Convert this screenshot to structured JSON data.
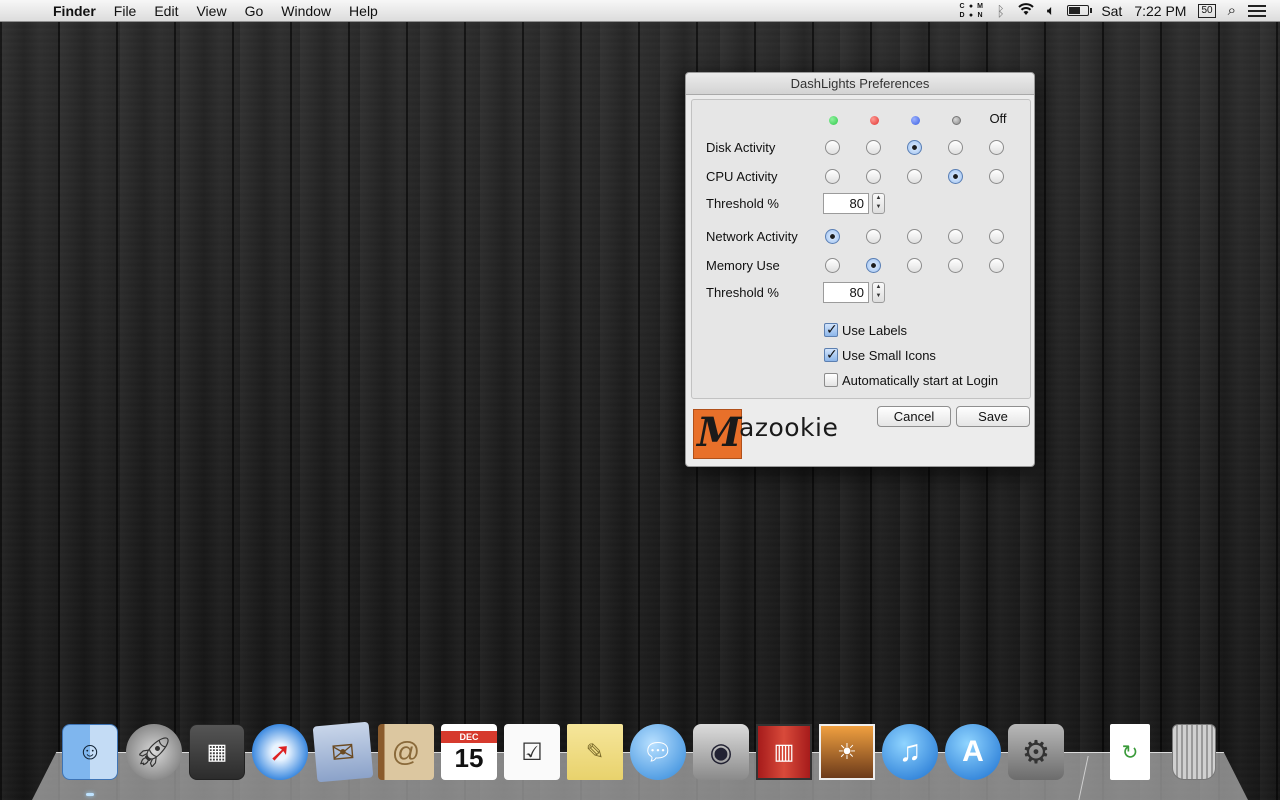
{
  "menubar": {
    "apple_glyph": "",
    "items": [
      {
        "label": "Finder",
        "bold": true
      },
      {
        "label": "File"
      },
      {
        "label": "Edit"
      },
      {
        "label": "View"
      },
      {
        "label": "Go"
      },
      {
        "label": "Window"
      },
      {
        "label": "Help"
      }
    ],
    "status": {
      "dashlights_letters": [
        "C",
        "",
        "M",
        "D",
        "",
        "N"
      ],
      "bluetooth_icon": "bluetooth-icon",
      "wifi_icon": "wifi-icon",
      "volume_icon": "volume-icon",
      "battery_level": 0.55,
      "day": "Sat",
      "time": "7:22 PM",
      "calendar_badge": "50"
    }
  },
  "dialog": {
    "title": "DashLights Preferences",
    "columns": [
      {
        "id": "green",
        "color": "#2ec84a"
      },
      {
        "id": "red",
        "color": "#e0322e"
      },
      {
        "id": "blue",
        "color": "#3a5fe0"
      },
      {
        "id": "gray",
        "color": "#8a8a8a"
      },
      {
        "id": "off",
        "label": "Off"
      }
    ],
    "rows": {
      "disk": {
        "label": "Disk Activity",
        "selected": "blue"
      },
      "cpu": {
        "label": "CPU Activity",
        "selected": "gray"
      },
      "cpu_threshold": {
        "label": "Threshold %",
        "value": "80"
      },
      "network": {
        "label": "Network Activity",
        "selected": "green"
      },
      "memory": {
        "label": "Memory Use",
        "selected": "red"
      },
      "memory_threshold": {
        "label": "Threshold %",
        "value": "80"
      }
    },
    "checkboxes": {
      "use_labels": {
        "label": "Use Labels",
        "checked": true
      },
      "use_small_icons": {
        "label": "Use Small Icons",
        "checked": true
      },
      "auto_start": {
        "label": "Automatically start at Login",
        "checked": false
      }
    },
    "buttons": {
      "cancel": "Cancel",
      "save": "Save"
    },
    "logo": {
      "mark": "M",
      "text": "azookie",
      "color": "#e8702a"
    }
  },
  "dock": {
    "apps": [
      {
        "name": "Finder",
        "icon": "finder-icon",
        "running": true
      },
      {
        "name": "Launchpad",
        "icon": "rocket-icon"
      },
      {
        "name": "Mission Control",
        "icon": "mission-control-icon"
      },
      {
        "name": "Safari",
        "icon": "compass-icon"
      },
      {
        "name": "Mail",
        "icon": "eagle-stamp-icon"
      },
      {
        "name": "Contacts",
        "icon": "address-book-icon"
      },
      {
        "name": "Calendar",
        "icon": "calendar-icon",
        "month": "DEC",
        "day": "15"
      },
      {
        "name": "Reminders",
        "icon": "checklist-icon"
      },
      {
        "name": "Notes",
        "icon": "notepad-icon"
      },
      {
        "name": "Messages",
        "icon": "chat-bubbles-icon"
      },
      {
        "name": "FaceTime",
        "icon": "video-camera-icon"
      },
      {
        "name": "Photo Booth",
        "icon": "photo-booth-icon"
      },
      {
        "name": "iPhoto",
        "icon": "camera-photo-icon"
      },
      {
        "name": "iTunes",
        "icon": "music-note-icon"
      },
      {
        "name": "App Store",
        "icon": "app-store-icon"
      },
      {
        "name": "System Preferences",
        "icon": "gear-icon"
      },
      {
        "name": "Document",
        "icon": "document-icon"
      },
      {
        "name": "Trash",
        "icon": "trash-icon"
      }
    ]
  }
}
